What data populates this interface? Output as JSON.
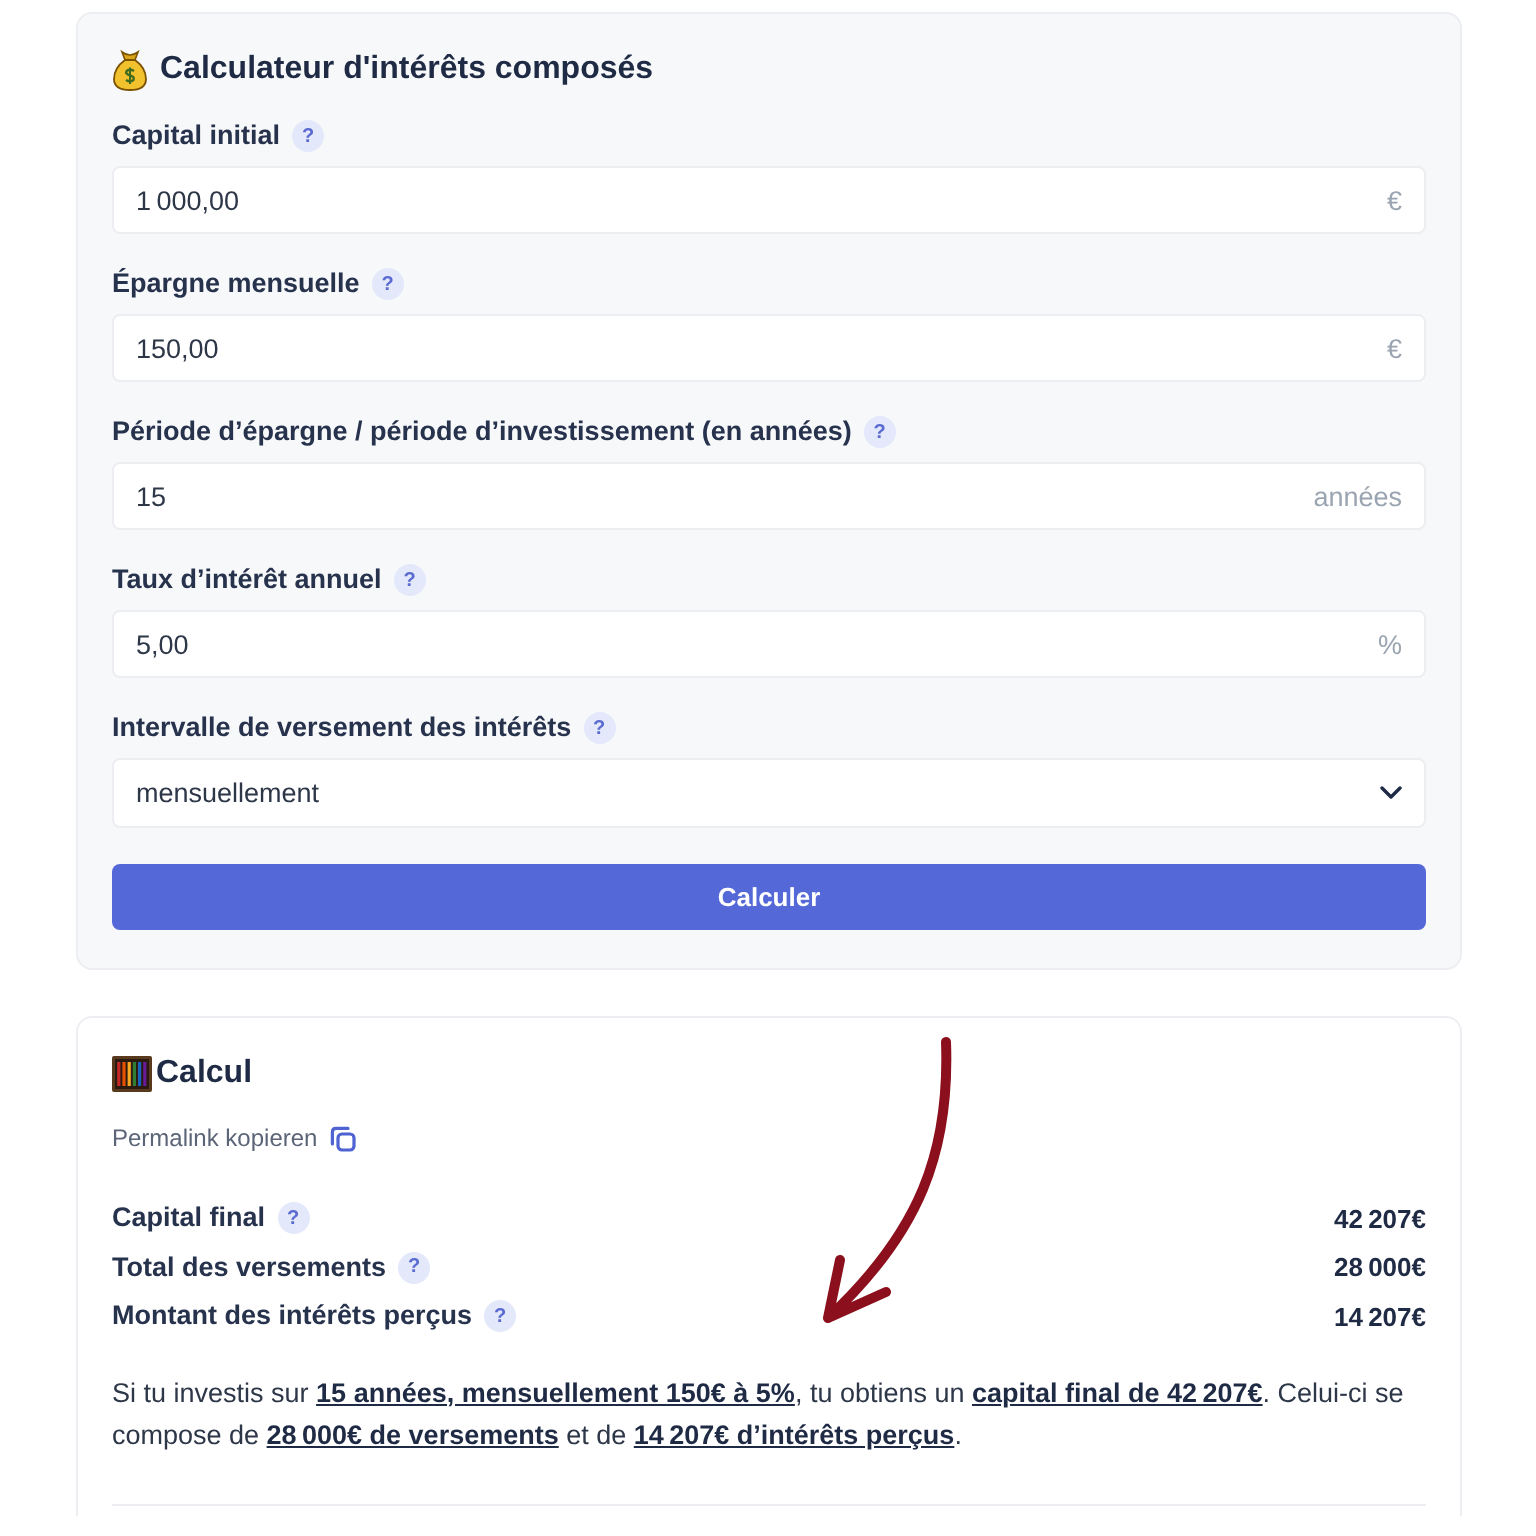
{
  "calculator": {
    "title": "Calculateur d'intérêts composés",
    "fields": [
      {
        "kind": "input",
        "label": "Capital initial",
        "help": "?",
        "value": "1 000,00",
        "suffix": "€"
      },
      {
        "kind": "input",
        "label": "Épargne mensuelle",
        "help": "?",
        "value": "150,00",
        "suffix": "€"
      },
      {
        "kind": "input",
        "label": "Période d’épargne / période d’investissement (en années)",
        "help": "?",
        "value": "15",
        "suffix": "années"
      },
      {
        "kind": "input",
        "label": "Taux d’intérêt annuel",
        "help": "?",
        "value": "5,00",
        "suffix": "%"
      },
      {
        "kind": "select",
        "label": "Intervalle de versement des intérêts",
        "help": "?",
        "value": "mensuellement"
      }
    ],
    "submit_button": "Calculer"
  },
  "results": {
    "title": "Calcul",
    "permalink": "Permalink kopieren",
    "rows": [
      {
        "label": "Capital final",
        "help": "?",
        "value": "42 207€"
      },
      {
        "label": "Total des versements",
        "help": "?",
        "value": "28 000€"
      },
      {
        "label": "Montant des intérêts perçus",
        "help": "?",
        "value": "14 207€"
      }
    ],
    "summary": [
      {
        "kind": "text",
        "text": "Si tu investis sur "
      },
      {
        "kind": "link",
        "text": "15 années, mensuellement 150€ à 5%"
      },
      {
        "kind": "text",
        "text": ", tu obtiens un "
      },
      {
        "kind": "link",
        "text": "capital final de 42 207€"
      },
      {
        "kind": "text",
        "text": ". Celui-ci se compose de "
      },
      {
        "kind": "link",
        "text": "28 000€ de versements"
      },
      {
        "kind": "text",
        "text": " et de "
      },
      {
        "kind": "link",
        "text": "14 207€ d’intérêts perçus"
      },
      {
        "kind": "text",
        "text": "."
      }
    ]
  }
}
